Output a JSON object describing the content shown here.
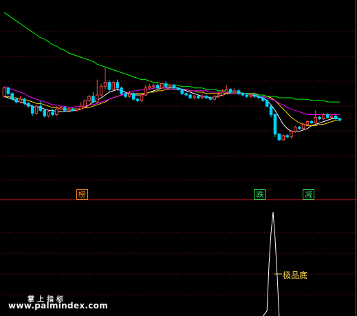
{
  "chart_data": [
    {
      "type": "candlestick",
      "panel": "price",
      "grid": "dotted horizontal",
      "colors": {
        "up": "#ff4b4b",
        "down": "#00d2ff",
        "ma_short": "#ffffff",
        "ma_mid": "#ffd700",
        "ma_long": "#ff00ff",
        "ma_longest": "#00ff00"
      },
      "candles": [
        [
          35,
          41,
          34,
          42
        ],
        [
          41,
          37,
          36,
          42
        ],
        [
          37,
          33,
          32,
          38
        ],
        [
          33,
          31,
          30,
          34
        ],
        [
          31,
          33,
          30,
          35
        ],
        [
          33,
          30,
          29,
          34
        ],
        [
          30,
          28,
          27,
          31
        ],
        [
          28,
          23,
          21,
          29
        ],
        [
          23,
          28,
          22,
          29
        ],
        [
          28,
          25,
          24,
          32
        ],
        [
          25,
          21,
          20,
          26
        ],
        [
          21,
          24,
          20,
          25
        ],
        [
          24,
          22,
          21,
          26
        ],
        [
          22,
          26,
          21,
          28
        ],
        [
          26,
          27,
          25,
          28
        ],
        [
          27,
          25,
          24,
          28
        ],
        [
          25,
          26,
          24,
          27
        ],
        [
          26,
          25,
          24,
          27
        ],
        [
          25,
          26,
          24,
          27
        ],
        [
          26,
          28,
          25,
          31
        ],
        [
          28,
          32,
          27,
          33
        ],
        [
          32,
          35,
          31,
          36
        ],
        [
          35,
          31,
          30,
          38
        ],
        [
          31,
          36,
          30,
          47
        ],
        [
          36,
          42,
          35,
          44
        ],
        [
          42,
          45,
          40,
          56
        ],
        [
          45,
          40,
          38,
          47
        ],
        [
          40,
          45,
          39,
          46
        ],
        [
          45,
          41,
          39,
          47
        ],
        [
          41,
          37,
          36,
          42
        ],
        [
          37,
          35,
          34,
          38
        ],
        [
          35,
          37,
          34,
          39
        ],
        [
          37,
          33,
          32,
          38
        ],
        [
          33,
          32,
          31,
          34
        ],
        [
          32,
          36,
          31,
          37
        ],
        [
          36,
          41,
          35,
          43
        ],
        [
          41,
          42,
          40,
          44
        ],
        [
          42,
          43,
          40,
          44
        ],
        [
          43,
          41,
          39,
          44
        ],
        [
          41,
          44,
          40,
          45
        ],
        [
          44,
          42,
          41,
          46
        ],
        [
          42,
          43,
          41,
          44
        ],
        [
          43,
          41,
          40,
          44
        ],
        [
          41,
          40,
          39,
          42
        ],
        [
          40,
          37,
          36,
          41
        ],
        [
          37,
          36,
          35,
          38
        ],
        [
          36,
          34,
          33,
          37
        ],
        [
          34,
          35,
          33,
          36
        ],
        [
          35,
          34,
          33,
          36
        ],
        [
          34,
          35,
          33,
          37
        ],
        [
          35,
          34,
          33,
          36
        ],
        [
          34,
          33,
          32,
          35
        ],
        [
          33,
          35,
          32,
          36
        ],
        [
          35,
          36,
          34,
          38
        ],
        [
          36,
          38,
          35,
          40
        ],
        [
          38,
          40,
          37,
          43
        ],
        [
          40,
          38,
          37,
          41
        ],
        [
          38,
          39,
          37,
          41
        ],
        [
          39,
          37,
          36,
          40
        ],
        [
          37,
          36,
          35,
          38
        ],
        [
          36,
          35,
          34,
          37
        ],
        [
          35,
          36,
          34,
          37
        ],
        [
          36,
          35,
          34,
          37
        ],
        [
          35,
          34,
          33,
          36
        ],
        [
          34,
          32,
          31,
          35
        ],
        [
          32,
          28,
          27,
          33
        ],
        [
          28,
          22,
          20,
          29
        ],
        [
          22,
          8,
          6,
          23
        ],
        [
          8,
          4,
          3,
          9
        ],
        [
          4,
          7,
          3,
          8
        ],
        [
          7,
          6,
          5,
          8
        ],
        [
          6,
          10,
          5,
          11
        ],
        [
          10,
          13,
          9,
          14
        ],
        [
          13,
          12,
          11,
          14
        ],
        [
          12,
          15,
          11,
          16
        ],
        [
          15,
          17,
          14,
          18
        ],
        [
          17,
          16,
          15,
          18
        ],
        [
          16,
          20,
          15,
          25
        ],
        [
          20,
          19,
          18,
          21
        ],
        [
          19,
          22,
          18,
          23
        ],
        [
          22,
          20,
          19,
          23
        ],
        [
          20,
          21,
          19,
          22
        ],
        [
          21,
          19,
          18,
          22
        ],
        [
          19,
          18,
          17,
          20
        ]
      ],
      "moving_averages": {
        "ma_short": [
          35,
          34,
          33,
          32,
          31,
          30,
          29,
          28,
          27,
          27,
          26,
          25,
          25,
          24,
          24,
          24,
          24,
          25,
          25,
          26,
          27,
          29,
          31,
          32,
          34,
          36,
          38,
          39,
          40,
          39,
          38,
          37,
          36,
          36,
          36,
          37,
          38,
          39,
          40,
          41,
          41,
          41,
          41,
          41,
          40,
          39,
          38,
          37,
          36,
          35,
          35,
          34,
          34,
          35,
          36,
          37,
          38,
          38,
          38,
          37,
          37,
          36,
          35,
          35,
          34,
          32,
          29,
          25,
          20,
          15,
          12,
          10,
          10,
          10,
          11,
          12,
          14,
          15,
          16,
          17,
          18,
          19,
          19,
          19
        ],
        "ma_mid": [
          35,
          35,
          34,
          34,
          33,
          33,
          32,
          31,
          30,
          30,
          29,
          28,
          27,
          27,
          26,
          26,
          26,
          26,
          26,
          26,
          27,
          27,
          28,
          29,
          30,
          31,
          33,
          34,
          35,
          36,
          37,
          37,
          37,
          37,
          37,
          37,
          38,
          38,
          39,
          39,
          40,
          40,
          40,
          40,
          40,
          40,
          39,
          39,
          38,
          38,
          37,
          37,
          37,
          37,
          37,
          37,
          37,
          37,
          37,
          37,
          37,
          37,
          37,
          36,
          36,
          35,
          34,
          32,
          29,
          26,
          23,
          20,
          18,
          16,
          15,
          14,
          14,
          14,
          15,
          15,
          16,
          17,
          18,
          18
        ],
        "ma_long": [
          42,
          41,
          40,
          39,
          38,
          37,
          35,
          34,
          33,
          32,
          31,
          30,
          29,
          29,
          28,
          28,
          27,
          27,
          28,
          28,
          28,
          29,
          29,
          30,
          31,
          32,
          33,
          34,
          35,
          36,
          37,
          38,
          39,
          39,
          40,
          40,
          40,
          41,
          41,
          41,
          41,
          40,
          40,
          40,
          40,
          40,
          39,
          39,
          39,
          39,
          39,
          38,
          38,
          38,
          38,
          38,
          37,
          37,
          37,
          37,
          37,
          36,
          36,
          35,
          35,
          34,
          33,
          32,
          30,
          29,
          27,
          26,
          25,
          24,
          23,
          22,
          22,
          22,
          22,
          22,
          22,
          22,
          22,
          22
        ],
        "ma_longest": [
          95,
          93,
          91,
          89,
          87,
          85,
          83,
          81,
          79,
          77,
          76,
          74,
          72,
          71,
          69,
          68,
          66,
          65,
          64,
          63,
          62,
          61,
          60,
          58,
          57,
          56,
          55,
          54,
          53,
          52,
          51,
          50,
          49,
          48,
          47,
          47,
          46,
          45,
          45,
          44,
          44,
          43,
          43,
          43,
          42,
          42,
          42,
          41,
          41,
          41,
          40,
          40,
          40,
          39,
          39,
          39,
          38,
          38,
          38,
          37,
          37,
          37,
          36,
          36,
          36,
          35,
          35,
          35,
          34,
          34,
          34,
          34,
          33,
          33,
          33,
          33,
          32,
          32,
          32,
          32,
          31,
          31,
          31,
          31
        ]
      },
      "ylim": [
        -30,
        100
      ],
      "annotations": [
        {
          "text": "榜",
          "candle_index": 19,
          "color": "#ff8b1a"
        },
        {
          "text": "跌",
          "candle_index": 63,
          "color": "#2fe05a"
        },
        {
          "text": "减",
          "candle_index": 75,
          "color": "#2fe05a"
        }
      ]
    },
    {
      "type": "line",
      "panel": "indicator",
      "grid": "dotted horizontal",
      "series_color": "#ffffff",
      "x_index": [
        64,
        65,
        65.5,
        66,
        66.5,
        67,
        67.5,
        68
      ],
      "values": [
        0,
        5,
        50,
        80,
        100,
        75,
        40,
        0
      ],
      "ylim": [
        0,
        100
      ],
      "label": {
        "text": "极品底",
        "color": "#ffd84a"
      }
    }
  ],
  "watermark": {
    "title": "掌上指标",
    "url": "www.palmindex.com"
  }
}
